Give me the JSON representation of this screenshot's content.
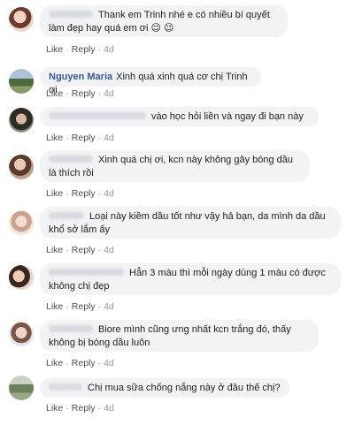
{
  "actions": {
    "like": "Like",
    "reply": "Reply",
    "dot": "·"
  },
  "comments": [
    {
      "name": "",
      "text": "Thank em Trinh nhé e có nhiều bí quyết làm đẹp hay quá em ơi 😉 😉",
      "time": "4d"
    },
    {
      "name": "Nguyen Maria",
      "text": "Xinh quá xinh quá cơ chị Trinh ơi",
      "time": "4d"
    },
    {
      "name": "",
      "text": "vào học hỏi liền và ngay đi bạn này",
      "time": "4d"
    },
    {
      "name": "",
      "text": "Xinh quá chị ơi, kcn này không gây bóng dầu là thích rồi",
      "time": "4d"
    },
    {
      "name": "",
      "text": "Loại này kiềm dầu tốt như vậy hả bạn, da mình da dầu khổ sở lắm ấy",
      "time": "4d"
    },
    {
      "name": "",
      "text": "Hẳn 3 màu thì mỗi ngày dùng 1 màu có được không chị đẹp",
      "time": "4d"
    },
    {
      "name": "",
      "text": "Biore mình cũng ưng nhất kcn trắng đó, thấy không bị bóng dầu luôn",
      "time": "4d"
    },
    {
      "name": "",
      "text": "Chị mua sữa chống nắng này ở đâu thế chị?",
      "time": "4d"
    }
  ]
}
